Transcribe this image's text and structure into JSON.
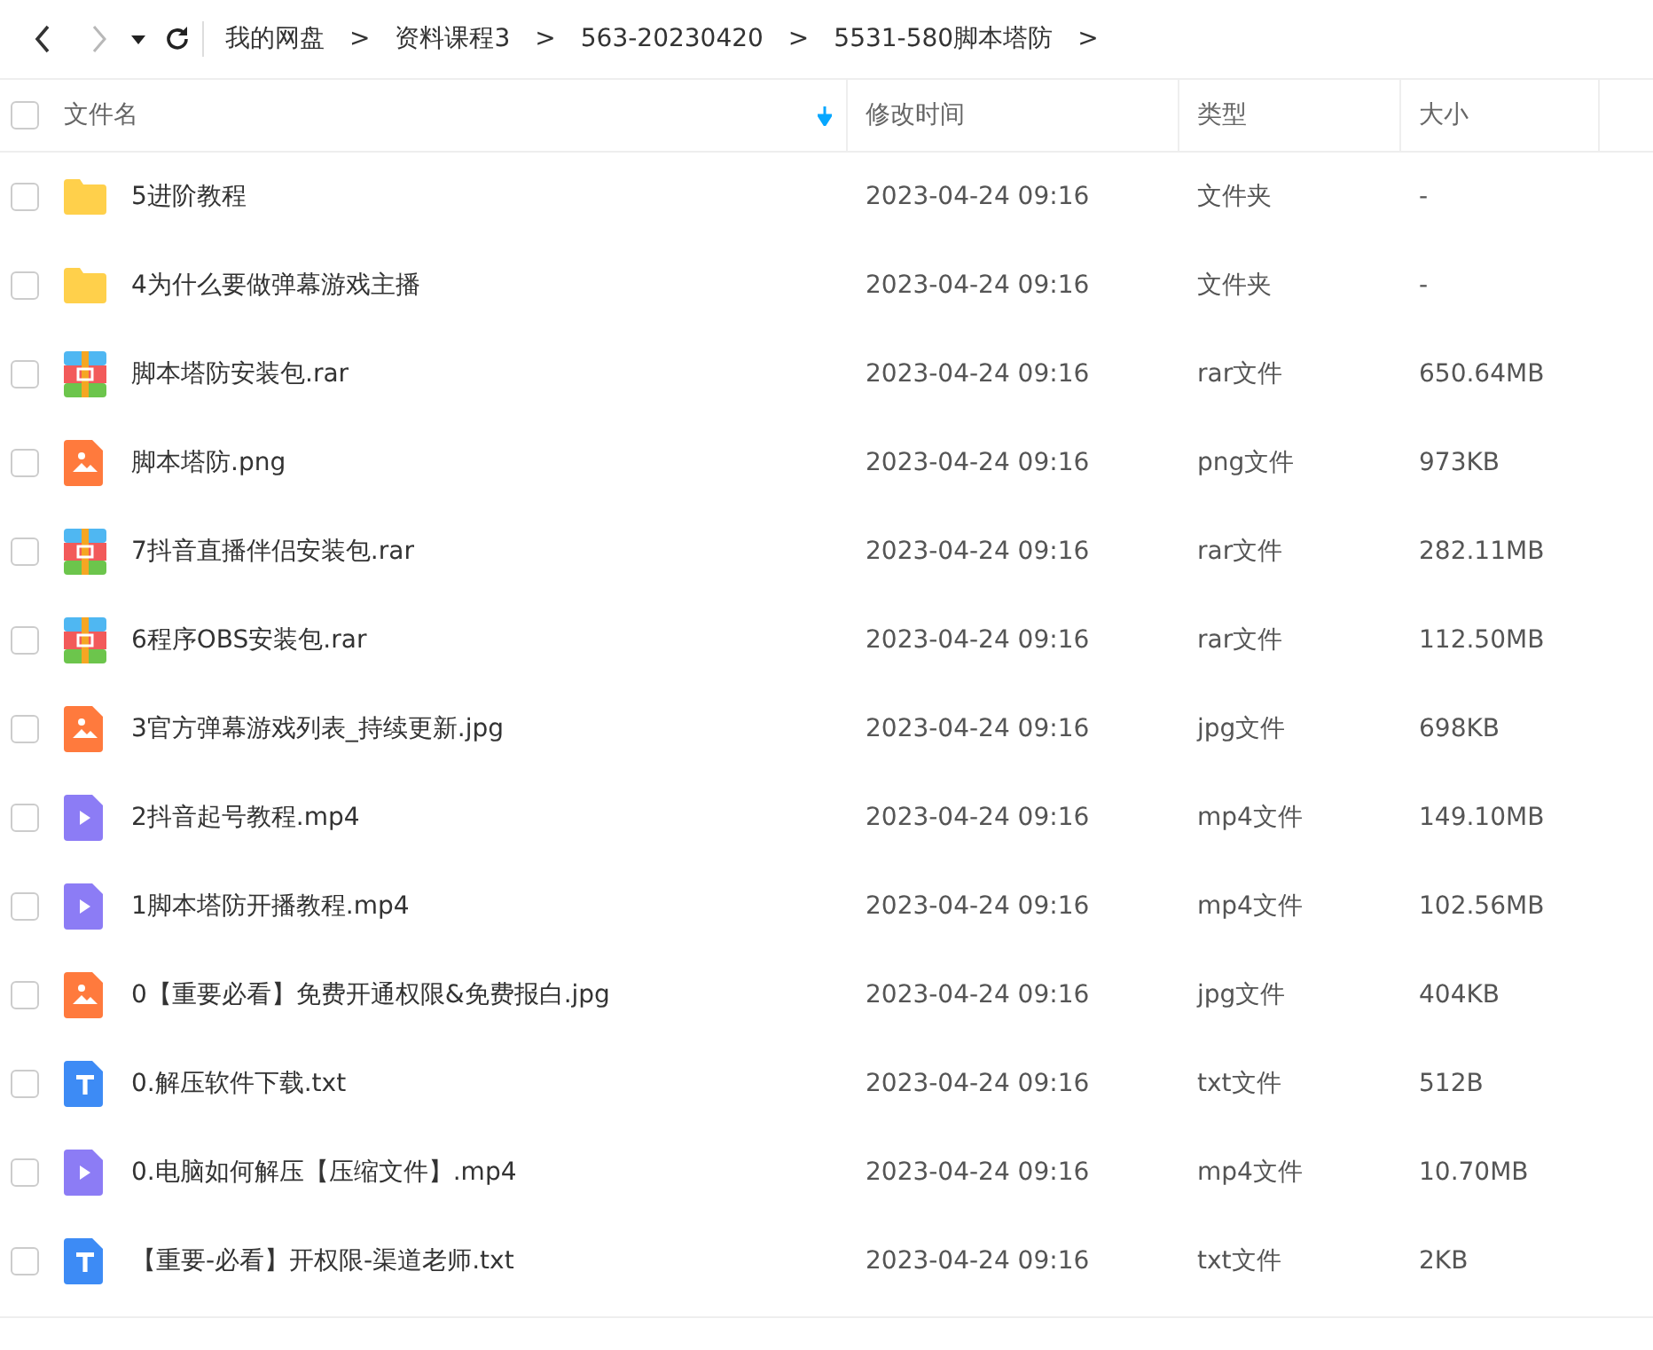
{
  "nav": {
    "back_disabled": false,
    "forward_disabled": true
  },
  "breadcrumb": [
    {
      "kind": "crumb",
      "text": "我的网盘"
    },
    {
      "kind": "separator",
      "text": ">"
    },
    {
      "kind": "crumb",
      "text": "资料课程3"
    },
    {
      "kind": "separator",
      "text": ">"
    },
    {
      "kind": "crumb",
      "text": "563-20230420"
    },
    {
      "kind": "separator",
      "text": ">"
    },
    {
      "kind": "crumb",
      "text": "5531-580脚本塔防"
    },
    {
      "kind": "separator",
      "text": ">"
    }
  ],
  "table": {
    "select_all_checked": false,
    "columns": [
      {
        "label": "文件名",
        "sorted": true
      },
      {
        "label": "修改时间",
        "sorted": false
      },
      {
        "label": "类型",
        "sorted": false
      },
      {
        "label": "大小",
        "sorted": false
      }
    ],
    "rows": [
      {
        "kind": "folder",
        "name": "5进阶教程",
        "modified": "2023-04-24 09:16",
        "type": "文件夹",
        "size": "-",
        "checked": false
      },
      {
        "kind": "folder",
        "name": "4为什么要做弹幕游戏主播",
        "modified": "2023-04-24 09:16",
        "type": "文件夹",
        "size": "-",
        "checked": false
      },
      {
        "kind": "archive",
        "name": "脚本塔防安装包.rar",
        "modified": "2023-04-24 09:16",
        "type": "rar文件",
        "size": "650.64MB",
        "checked": false
      },
      {
        "kind": "image",
        "name": "脚本塔防.png",
        "modified": "2023-04-24 09:16",
        "type": "png文件",
        "size": "973KB",
        "checked": false
      },
      {
        "kind": "archive",
        "name": "7抖音直播伴侣安装包.rar",
        "modified": "2023-04-24 09:16",
        "type": "rar文件",
        "size": "282.11MB",
        "checked": false
      },
      {
        "kind": "archive",
        "name": "6程序OBS安装包.rar",
        "modified": "2023-04-24 09:16",
        "type": "rar文件",
        "size": "112.50MB",
        "checked": false
      },
      {
        "kind": "image",
        "name": "3官方弹幕游戏列表_持续更新.jpg",
        "modified": "2023-04-24 09:16",
        "type": "jpg文件",
        "size": "698KB",
        "checked": false
      },
      {
        "kind": "video",
        "name": "2抖音起号教程.mp4",
        "modified": "2023-04-24 09:16",
        "type": "mp4文件",
        "size": "149.10MB",
        "checked": false
      },
      {
        "kind": "video",
        "name": "1脚本塔防开播教程.mp4",
        "modified": "2023-04-24 09:16",
        "type": "mp4文件",
        "size": "102.56MB",
        "checked": false
      },
      {
        "kind": "image",
        "name": "0【重要必看】免费开通权限&免费报白.jpg",
        "modified": "2023-04-24 09:16",
        "type": "jpg文件",
        "size": "404KB",
        "checked": false
      },
      {
        "kind": "text",
        "name": "0.解压软件下载.txt",
        "modified": "2023-04-24 09:16",
        "type": "txt文件",
        "size": "512B",
        "checked": false
      },
      {
        "kind": "video",
        "name": "0.电脑如何解压【压缩文件】.mp4",
        "modified": "2023-04-24 09:16",
        "type": "mp4文件",
        "size": "10.70MB",
        "checked": false
      },
      {
        "kind": "text",
        "name": "【重要-必看】开权限-渠道老师.txt",
        "modified": "2023-04-24 09:16",
        "type": "txt文件",
        "size": "2KB",
        "checked": false
      }
    ]
  }
}
